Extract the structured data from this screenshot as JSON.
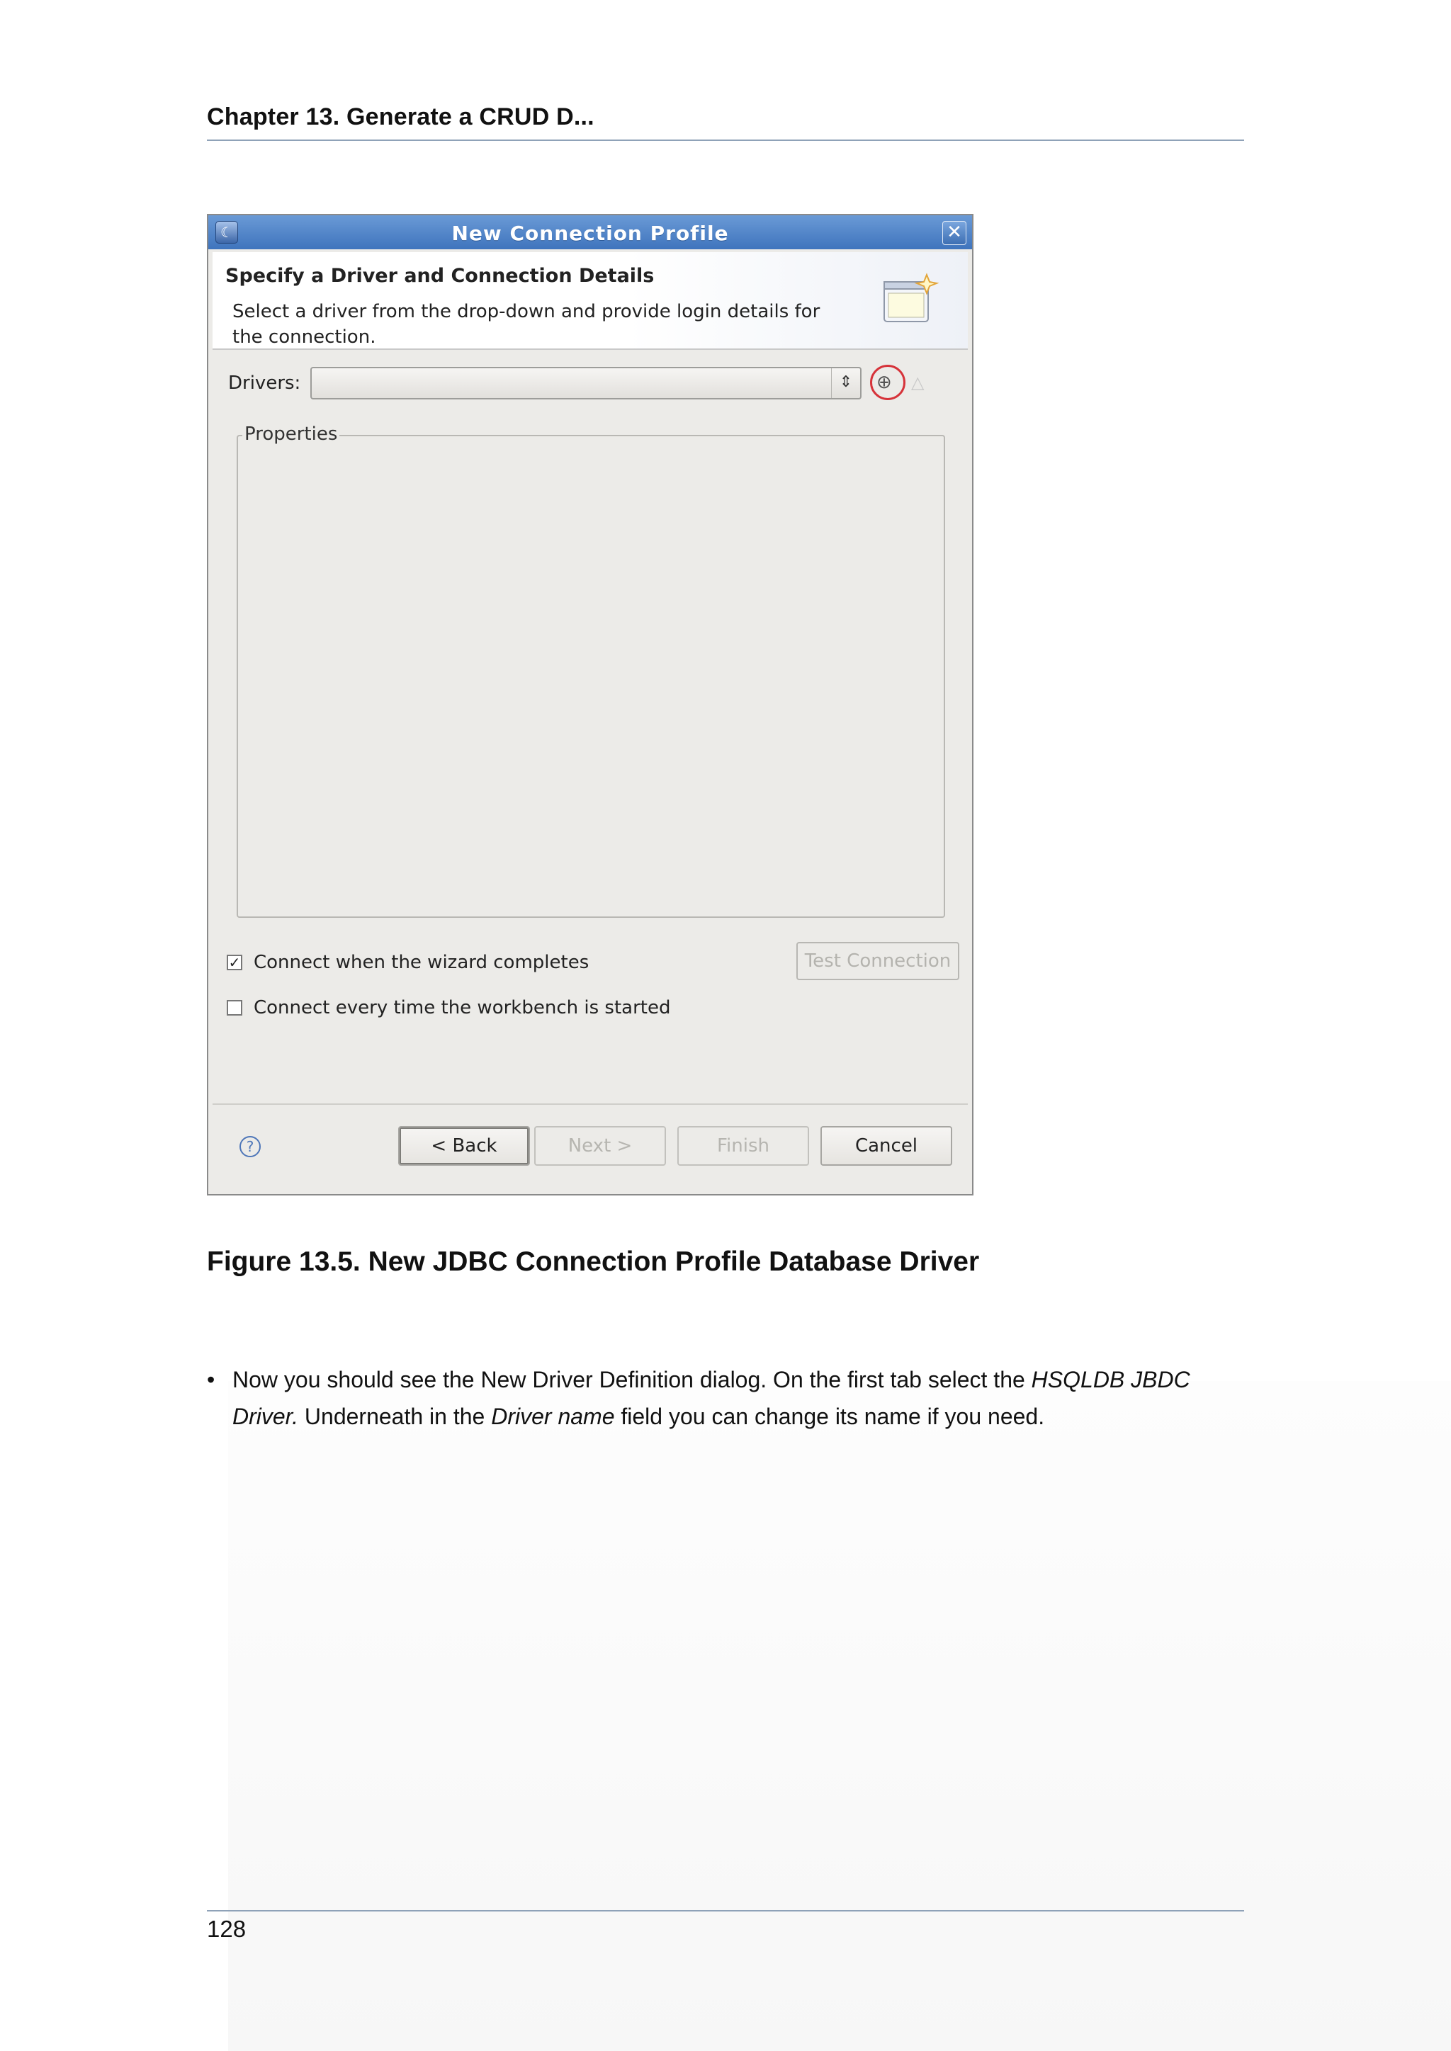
{
  "header": {
    "title": "Chapter 13. Generate a CRUD D..."
  },
  "dialog": {
    "title": "New Connection Profile",
    "close_glyph": "✕",
    "banner_title": "Specify a Driver and Connection Details",
    "banner_description": "Select a driver from the drop-down and provide login details for the connection.",
    "drivers_label": "Drivers:",
    "drivers_value": "",
    "properties_label": "Properties",
    "connect_when_completes": {
      "label": "Connect when the wizard completes",
      "checked": true
    },
    "connect_every_time": {
      "label": "Connect every time the workbench is started",
      "checked": false
    },
    "test_connection_label": "Test Connection",
    "help_glyph": "?",
    "buttons": {
      "back": "< Back",
      "next": "Next >",
      "finish": "Finish",
      "cancel": "Cancel"
    },
    "colors": {
      "titlebar": "#3f74bd",
      "highlight_circle": "#d6333a",
      "dialog_bg": "#ecebe8"
    }
  },
  "caption": "Figure 13.5. New JDBC Connection Profile Database Driver",
  "body": {
    "bullet": "•",
    "part1": "Now you should see the New Driver Definition dialog. On the first tab select the ",
    "em1": "HSQLDB JBDC Driver.",
    "part2": " Underneath in the ",
    "em2": "Driver name",
    "part3": " field you can change its name if you need."
  },
  "footer": {
    "page_number": "128"
  }
}
